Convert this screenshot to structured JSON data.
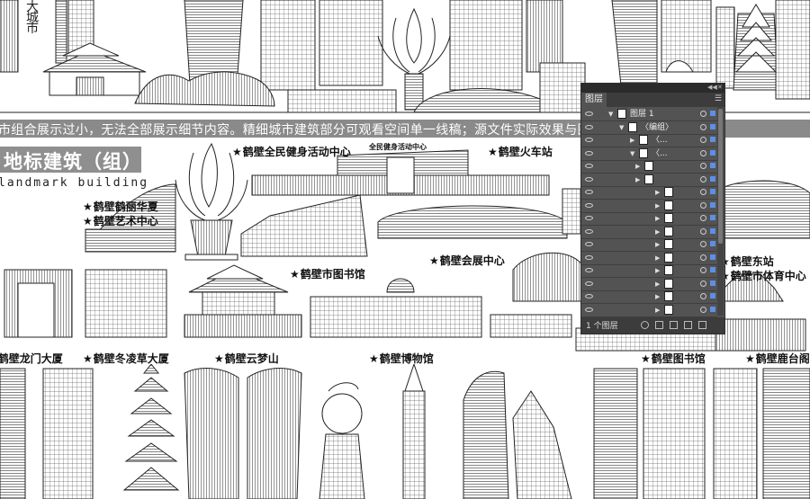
{
  "logo": {
    "chars": [
      "大",
      "城",
      "市"
    ]
  },
  "notice": "市组合展示过小，无法全部展示细节内容。精细城市建筑部分可观看空间单一线稿；源文件实际效果与图片一致。",
  "section": {
    "title": "地标建筑（组）",
    "subtitle": "landmark building"
  },
  "labels": {
    "fitness_center": "鹤壁全民健身活动中心",
    "train_station": "鹤壁火车站",
    "heli_huaxia": "鹤壁鹤丽华夏",
    "art_center": "鹤壁艺术中心",
    "library_city": "鹤壁市图书馆",
    "expo_center": "鹤壁会展中心",
    "east_station": "鹤壁东站",
    "stadium": "鹤壁市体育中心",
    "longmen": "鹤壁龙门大厦",
    "donglingcao": "鹤壁冬凌草大厦",
    "yunmeng": "鹤壁云梦山",
    "museum": "鹤壁博物馆",
    "library": "鹤壁图书馆",
    "lutai": "鹤壁鹿台阁",
    "fitness_sign": "全民健身活动中心"
  },
  "layers_panel": {
    "tab": "图层",
    "top_controls": [
      "◀◀",
      "✕"
    ],
    "menu_icon": "menu-icon",
    "rows": [
      {
        "name": "图层 1",
        "indent": 0,
        "expanded": true,
        "selected": true
      },
      {
        "name": "〈编组〉",
        "indent": 1,
        "expanded": true,
        "selected": true
      },
      {
        "name": "〈...",
        "indent": 2,
        "expanded": false,
        "selected": true
      },
      {
        "name": "〈...",
        "indent": 2,
        "expanded": true,
        "selected": true
      },
      {
        "name": "",
        "indent": 3,
        "expanded": false,
        "selected": true
      },
      {
        "name": "",
        "indent": 3,
        "expanded": false,
        "selected": true
      },
      {
        "name": "",
        "indent": 4,
        "expanded": false,
        "selected": true
      },
      {
        "name": "",
        "indent": 4,
        "expanded": false,
        "selected": true
      },
      {
        "name": "",
        "indent": 4,
        "expanded": false,
        "selected": true
      },
      {
        "name": "",
        "indent": 4,
        "expanded": false,
        "selected": true
      },
      {
        "name": "",
        "indent": 4,
        "expanded": false,
        "selected": true
      },
      {
        "name": "",
        "indent": 4,
        "expanded": false,
        "selected": true
      },
      {
        "name": "",
        "indent": 4,
        "expanded": false,
        "selected": true
      },
      {
        "name": "",
        "indent": 4,
        "expanded": false,
        "selected": true
      },
      {
        "name": "",
        "indent": 4,
        "expanded": false,
        "selected": true
      },
      {
        "name": "",
        "indent": 4,
        "expanded": false,
        "selected": true
      }
    ],
    "layer_count": "1 个图层",
    "accent": "#5d8fe4"
  }
}
